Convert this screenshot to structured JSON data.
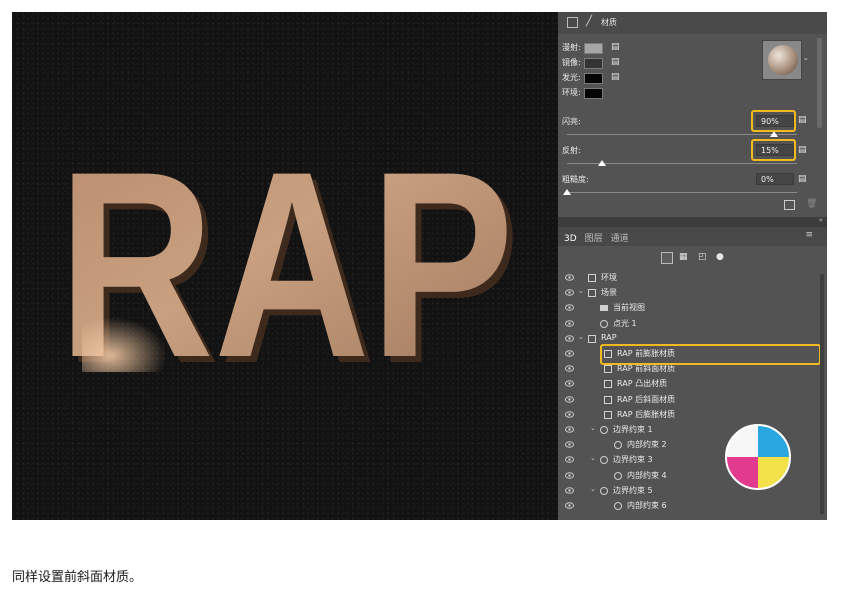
{
  "properties": {
    "title": "材质",
    "diffuse_label": "漫射:",
    "specular_label": "镜像:",
    "glow_label": "发光:",
    "ambient_label": "环境:",
    "shine_label": "闪亮:",
    "shine_value": "90%",
    "shine_level": 0.9,
    "reflection_label": "反射:",
    "reflection_value": "15%",
    "reflection_level": 0.15,
    "roughness_label": "粗糙度:",
    "roughness_value": "0%",
    "roughness_level": 0.0
  },
  "panel_tabs": [
    "3D",
    "图层",
    "通道"
  ],
  "scene_rows": [
    {
      "label": "环境",
      "icon": "environment-icon"
    },
    {
      "label": "场景",
      "icon": "scene-icon"
    },
    {
      "label": "当前视图",
      "icon": "camera-icon"
    },
    {
      "label": "点光 1",
      "icon": "light-icon"
    },
    {
      "label": "RAP",
      "icon": "mesh-icon"
    },
    {
      "label": "RAP 前膨胀材质",
      "icon": "material-icon"
    },
    {
      "label": "RAP 前斜面材质",
      "icon": "material-icon"
    },
    {
      "label": "RAP 凸出材质",
      "icon": "material-icon"
    },
    {
      "label": "RAP 后斜面材质",
      "icon": "material-icon"
    },
    {
      "label": "RAP 后膨胀材质",
      "icon": "material-icon"
    },
    {
      "label": "边界约束 1",
      "icon": "constraint-icon"
    },
    {
      "label": "内部约束 2",
      "icon": "constraint-icon"
    },
    {
      "label": "边界约束 3",
      "icon": "constraint-icon"
    },
    {
      "label": "内部约束 4",
      "icon": "constraint-icon"
    },
    {
      "label": "边界约束 5",
      "icon": "constraint-icon"
    },
    {
      "label": "内部约束 6",
      "icon": "constraint-icon"
    }
  ],
  "canvas": {
    "text": "RAP"
  },
  "caption": "同样设置前斜面材质。",
  "colors": {
    "highlight": "#f0b91e",
    "panel_bg": "#535353",
    "text_fill": "#c99a77"
  }
}
